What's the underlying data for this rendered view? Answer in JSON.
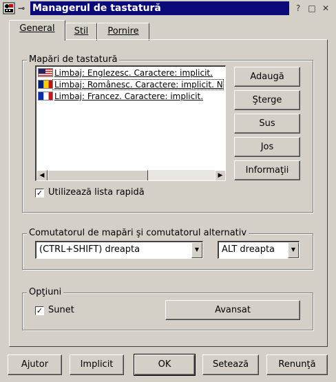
{
  "window": {
    "title": "Managerul de tastatură",
    "pin_glyph": "⊸",
    "help_glyph": "?",
    "minimize_glyph": "_",
    "maximize_glyph": "□",
    "close_glyph": "✕"
  },
  "tabs": [
    {
      "label": "General",
      "active": true
    },
    {
      "label": "Stil",
      "active": false
    },
    {
      "label": "Pornire",
      "active": false
    }
  ],
  "mappings_group": {
    "title": "Mapări de tastatură",
    "items": [
      {
        "flag": "us",
        "text": "Limbaj: Englezesc. Caractere: implicit.",
        "selected": false
      },
      {
        "flag": "ro",
        "text": "Limbaj: Românesc. Caractere: implicit. N",
        "selected": true
      },
      {
        "flag": "fr",
        "text": "Limbaj: Francez. Caractere: implicit.",
        "selected": false
      }
    ],
    "buttons": {
      "add": "Adaugă",
      "delete": "Şterge",
      "up": "Sus",
      "down": "Jos",
      "info": "Informaţii"
    },
    "quick_list_label": "Utilizează lista rapidă",
    "quick_list_checked": true
  },
  "switch_group": {
    "title": "Comutatorul de mapări şi comutatorul alternativ",
    "primary_value": "(CTRL+SHIFT) dreapta",
    "alternate_value": "ALT dreapta"
  },
  "options_group": {
    "title": "Opţiuni",
    "sound_label": "Sunet",
    "sound_checked": true,
    "advanced_label": "Avansat"
  },
  "footer": {
    "help": "Ajutor",
    "default": "Implicit",
    "ok": "OK",
    "apply": "Setează",
    "cancel": "Renunţă"
  },
  "colors": {
    "titlebar": "#0a0a7a",
    "window_bg": "#d4d0c8"
  }
}
